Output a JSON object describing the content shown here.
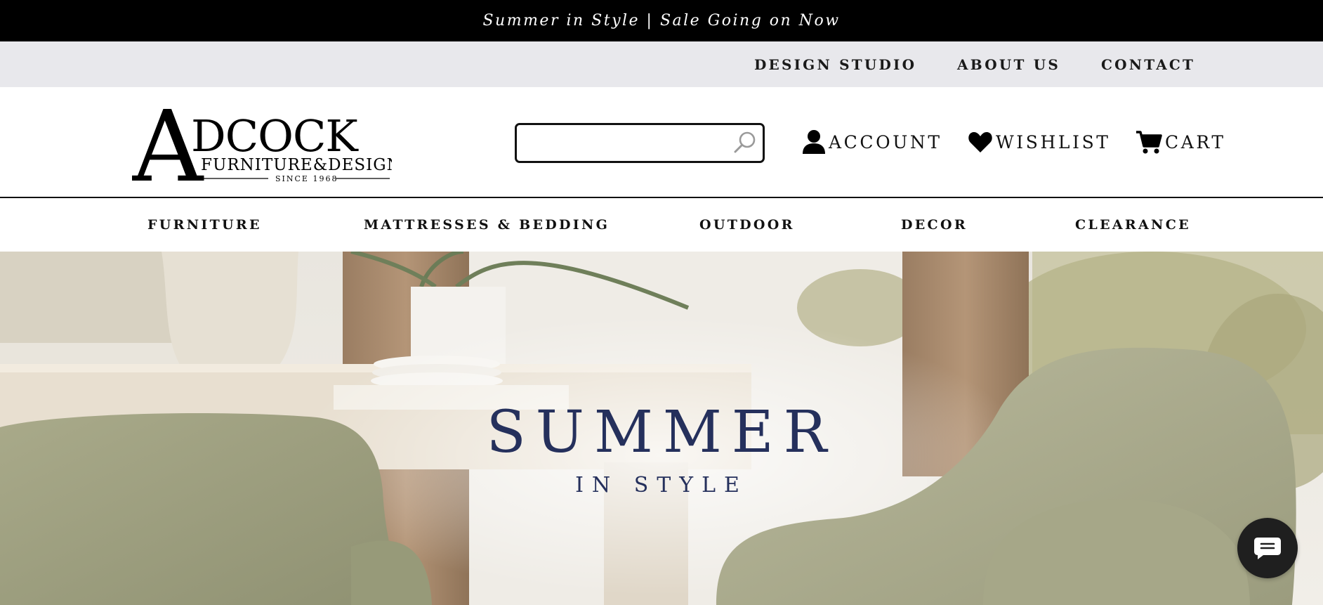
{
  "promo": {
    "text": "Summer in Style | Sale Going on Now"
  },
  "utility_nav": {
    "items": [
      {
        "label": "DESIGN STUDIO"
      },
      {
        "label": "ABOUT US"
      },
      {
        "label": "CONTACT"
      }
    ]
  },
  "header": {
    "logo": {
      "text": "ADCOCK",
      "subtitle": "FURNITURE&DESIGN",
      "since": "SINCE 1968"
    },
    "search": {
      "value": "",
      "placeholder": ""
    },
    "account": {
      "label": "ACCOUNT",
      "icon": "user-icon"
    },
    "wishlist": {
      "label": "WISHLIST",
      "icon": "heart-icon"
    },
    "cart": {
      "label": "CART",
      "icon": "cart-icon"
    }
  },
  "main_nav": {
    "items": [
      {
        "label": "FURNITURE"
      },
      {
        "label": "MATTRESSES & BEDDING"
      },
      {
        "label": "OUTDOOR"
      },
      {
        "label": "DECOR"
      },
      {
        "label": "CLEARANCE"
      }
    ]
  },
  "hero": {
    "headline": "SUMMER",
    "subheadline": "IN STYLE",
    "text_color": "#25305c"
  },
  "chat": {
    "icon": "chat-icon"
  }
}
